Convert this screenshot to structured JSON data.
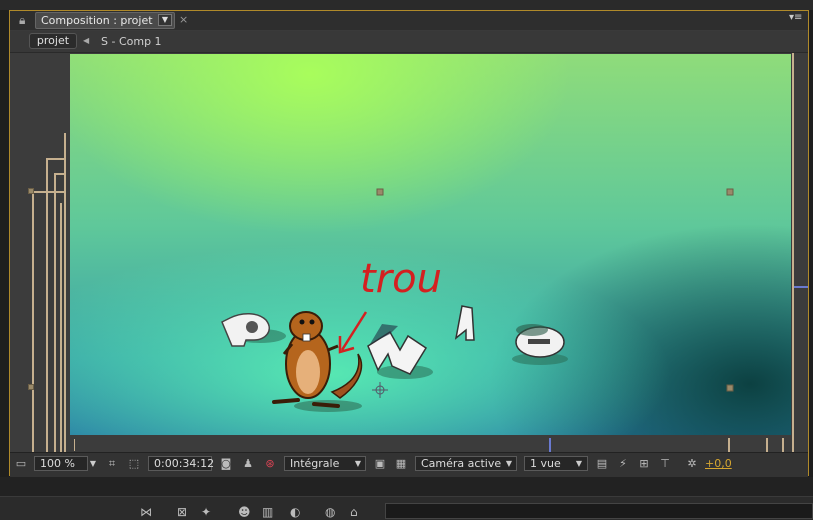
{
  "panel": {
    "tab_title": "Composition : projet",
    "close_glyph": "×",
    "menu_glyph": "▾≡"
  },
  "breadcrumb": {
    "current": "projet",
    "child": "S - Comp 1"
  },
  "canvas": {
    "annotation_text": "trou",
    "letters": [
      "P",
      "N",
      "A",
      "O"
    ]
  },
  "toolbar": {
    "zoom": "100 %",
    "timecode": "0:00:34:12",
    "resolution": "Intégrale",
    "camera": "Caméra active",
    "views": "1 vue",
    "exposure": "+0,0"
  },
  "colors": {
    "accent": "#d6a630",
    "panel_border": "#b08a2a",
    "annotation": "#d42020"
  }
}
